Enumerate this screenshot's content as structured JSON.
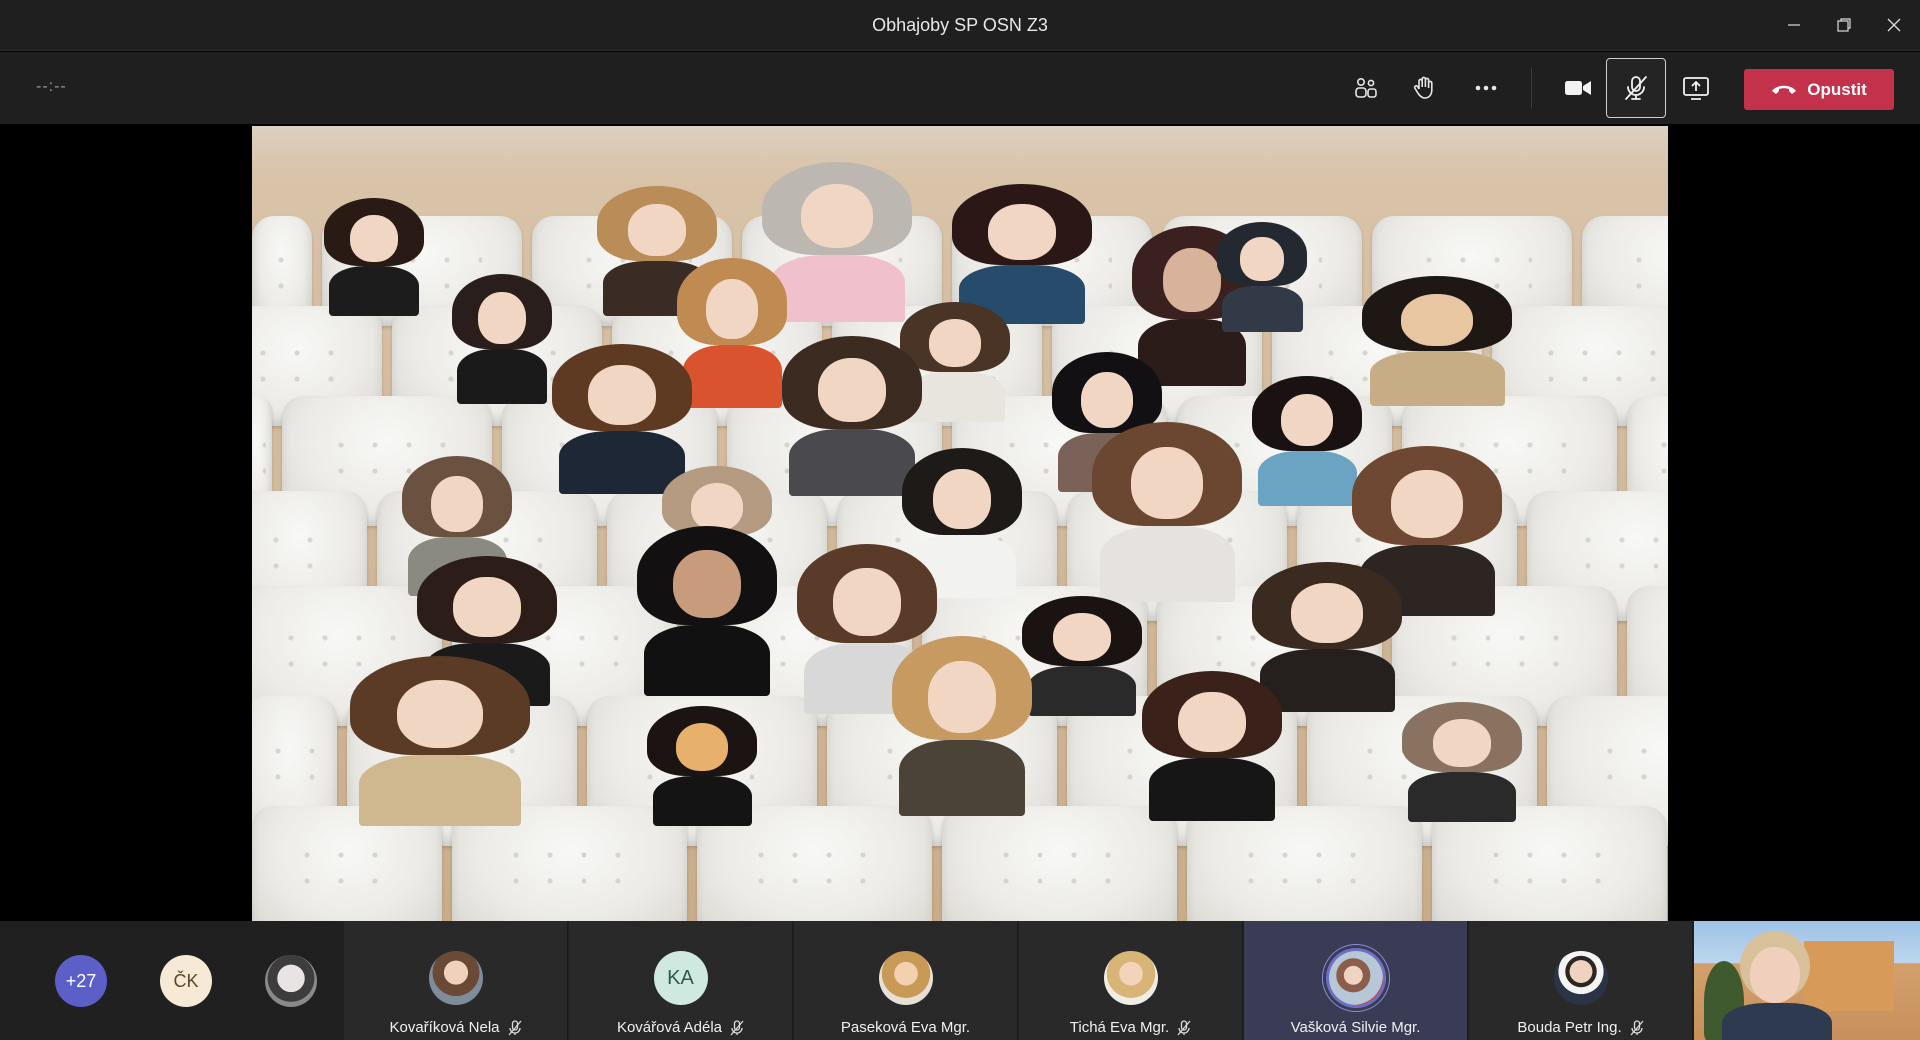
{
  "window": {
    "title": "Obhajoby SP OSN Z3",
    "controls": [
      "minimize-icon",
      "restore-icon",
      "close-icon"
    ]
  },
  "toolbar": {
    "timer": "--:--",
    "buttons": [
      {
        "name": "participants-icon"
      },
      {
        "name": "raise-hand-icon"
      },
      {
        "name": "more-options-icon"
      },
      {
        "name": "camera-icon"
      },
      {
        "name": "mic-muted-icon"
      },
      {
        "name": "share-screen-icon"
      }
    ],
    "leave_label": "Opustit",
    "leave_color": "#c4314b"
  },
  "strip": {
    "overflow_count": "+27",
    "overflow_color": "#5b5fc7",
    "ck_initials": "ČK",
    "participants": [
      {
        "name": "Kovaříková Nela",
        "muted": true,
        "avatar": "photo"
      },
      {
        "name": "Kovářová Adéla",
        "muted": true,
        "initials": "KA",
        "avatar": "initials"
      },
      {
        "name": "Paseková Eva Mgr.",
        "muted": false,
        "avatar": "photo"
      },
      {
        "name": "Tichá Eva Mgr.",
        "muted": true,
        "avatar": "photo"
      },
      {
        "name": "Vašková Silvie Mgr.",
        "muted": false,
        "avatar": "photo",
        "speaking": true
      },
      {
        "name": "Bouda Petr Ing.",
        "muted": true,
        "avatar": "photo"
      }
    ]
  }
}
